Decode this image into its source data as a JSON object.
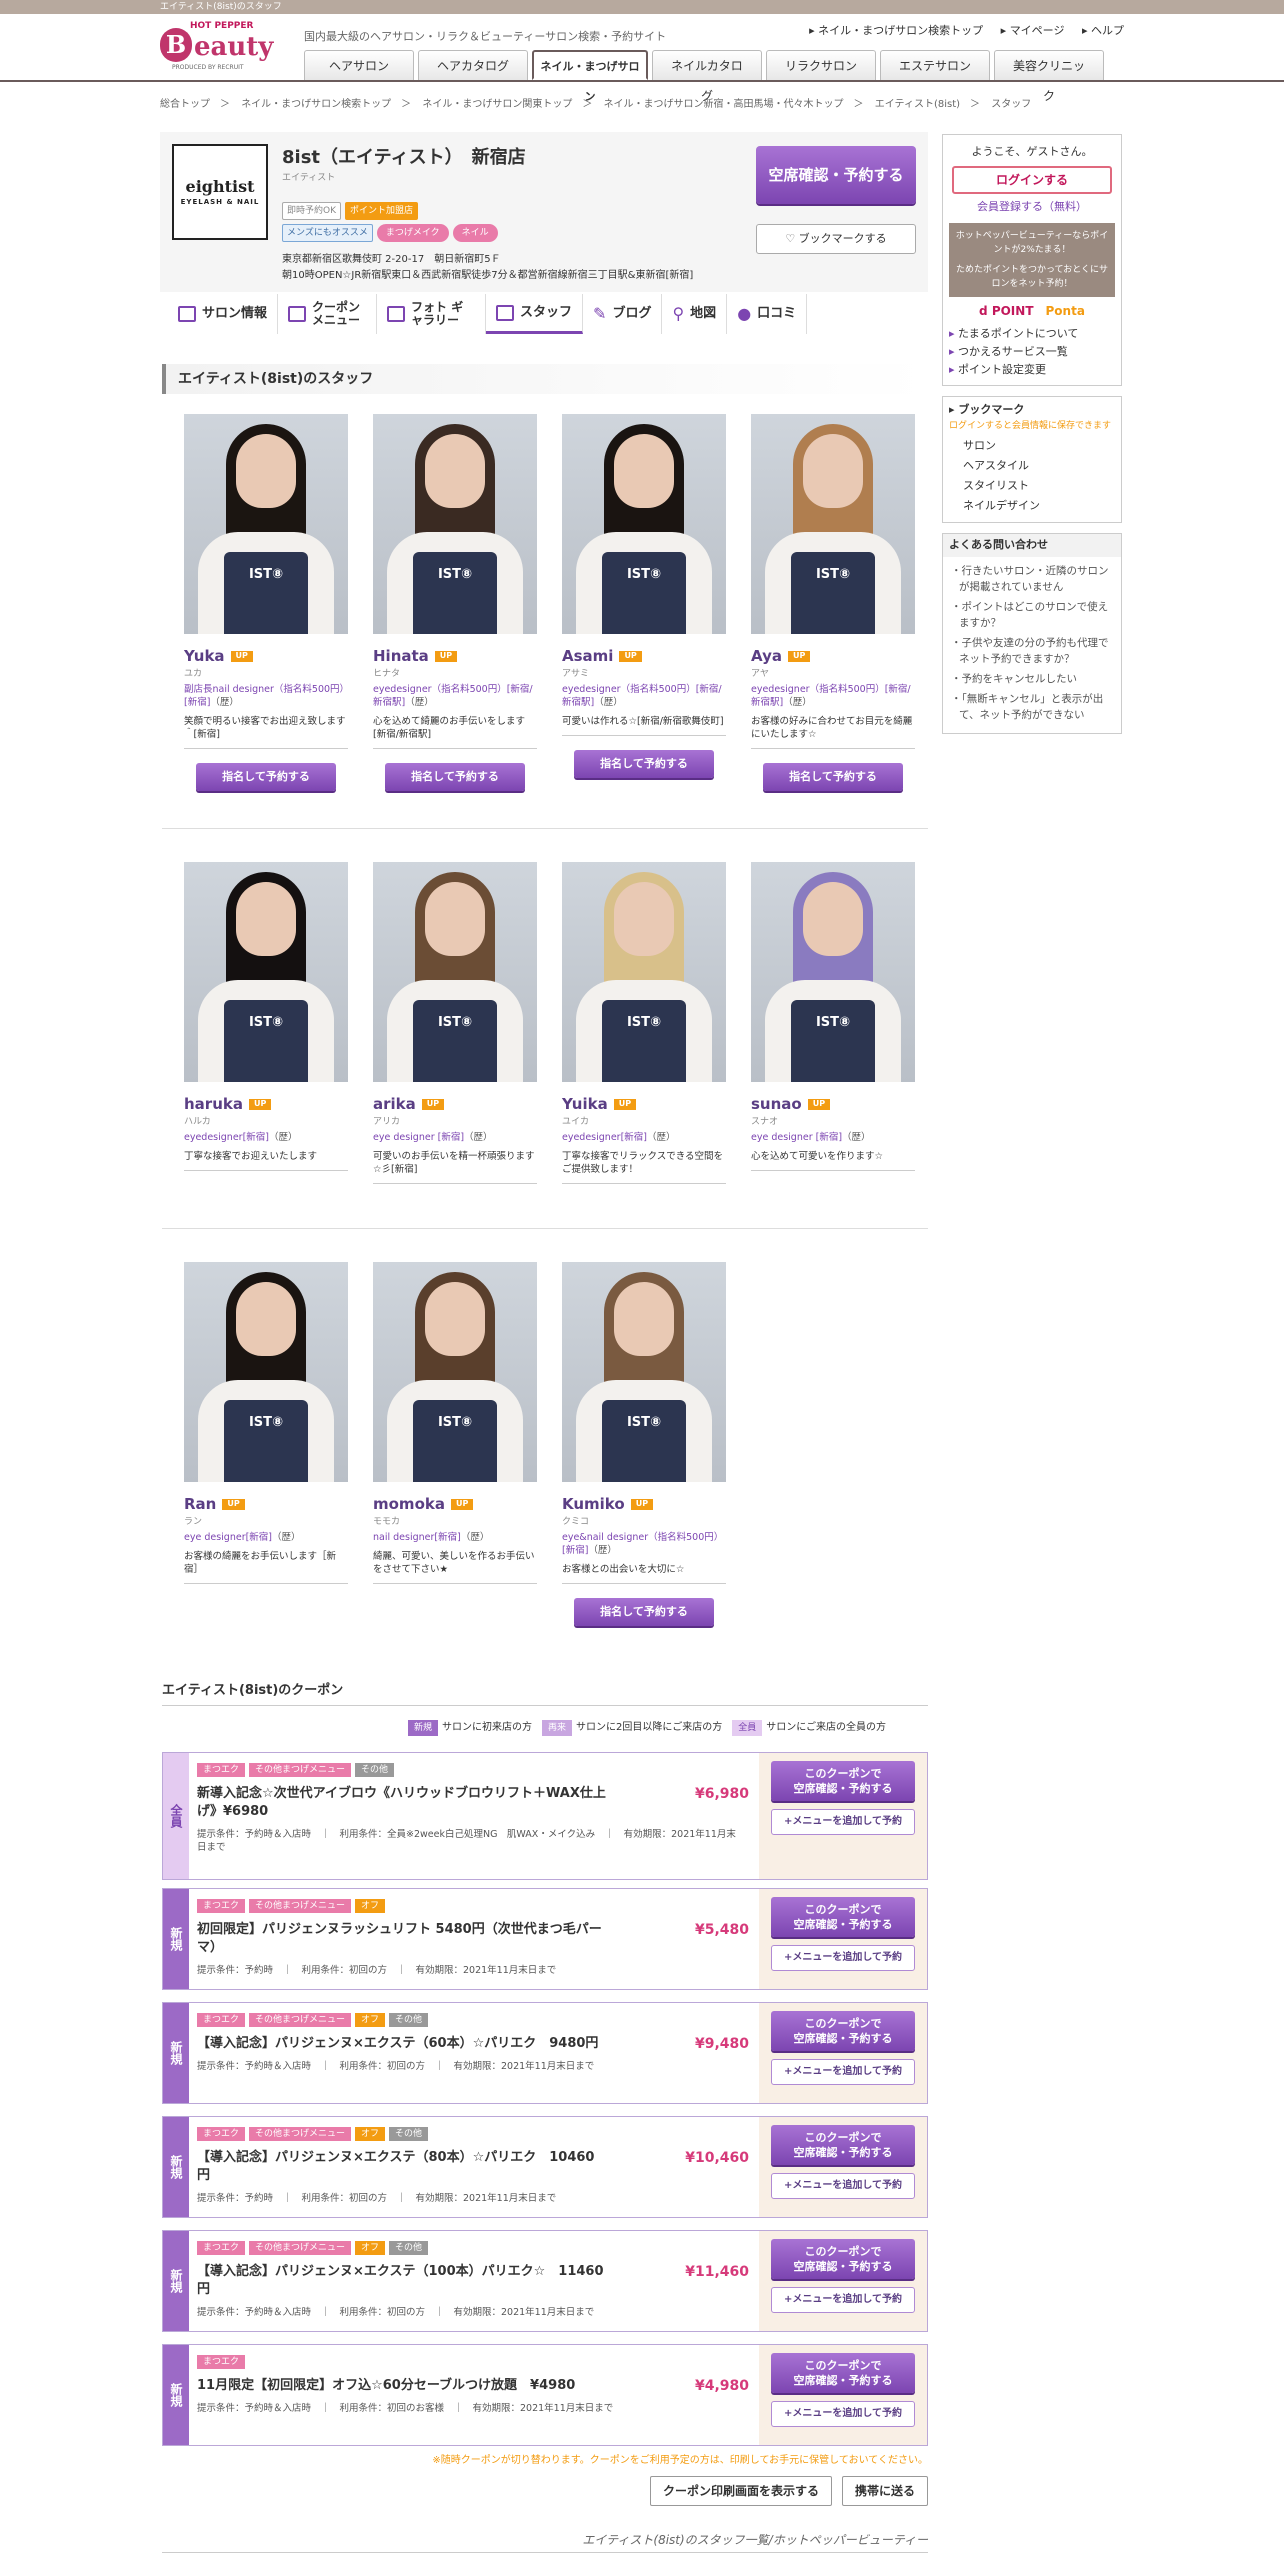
{
  "topbar": "エイティスト(8ist)のスタッフ",
  "header": {
    "logo_hp": "HOT PEPPER",
    "logo_b": "B",
    "logo_eauty": "eauty",
    "logo_prod": "PRODUCED BY RECRUIT",
    "tagline": "国内最大級のヘアサロン・リラク＆ビューティーサロン検索・予約サイト",
    "links": [
      "ネイル・まつげサロン検索トップ",
      "マイページ",
      "ヘルプ"
    ],
    "nav": [
      "ヘアサロン",
      "ヘアカタログ",
      "ネイル・まつげサロン",
      "ネイルカタログ",
      "リラクサロン",
      "エステサロン",
      "美容クリニック"
    ]
  },
  "breadcrumb": [
    "総合トップ　＞",
    "ネイル・まつげサロン検索トップ　＞",
    "ネイル・まつげサロン関東トップ　＞",
    "ネイル・まつげサロン新宿・高田馬場・代々木トップ　＞",
    "エイティスト(8ist)　＞",
    "スタッフ"
  ],
  "salon": {
    "logo": "eightist",
    "logo_sub": "EYELASH & NAIL",
    "name": "8ist（エイティスト）　新宿店",
    "kana": "エイティスト",
    "tags": [
      "即時予約OK",
      "ポイント加盟店",
      "メンズにもオススメ",
      "まつげメイク",
      "ネイル"
    ],
    "addr1": "東京都新宿区歌舞伎町 2-20-17　朝日新宿町5Ｆ",
    "addr2": "朝10時OPEN☆JR新宿駅東口＆西武新宿駅徒歩7分＆都営新宿線新宿三丁目駅&東新宿[新宿]",
    "reserve": "空席確認・予約する",
    "bookmark": "ブックマークする"
  },
  "subnav": [
    "サロン情報",
    "クーポン メニュー",
    "フォト ギャラリー",
    "スタッフ",
    "ブログ",
    "地図",
    "口コミ"
  ],
  "staff_title": "エイティスト(8ist)のスタッフ",
  "up": "UP",
  "hist": "（歴）",
  "reserve_btn": "指名して予約する",
  "staff": [
    {
      "name": "Yuka",
      "kana": "ユカ",
      "role": "副店長nail designer（指名料500円）[新宿]",
      "desc": "笑顔で明るい接客でお出迎え致します＾[新宿]",
      "hair": "#1b1511",
      "btn": true
    },
    {
      "name": "Hinata",
      "kana": "ヒナタ",
      "role": "eyedesigner（指名料500円）[新宿/新宿駅]",
      "desc": "心を込めて綺麗のお手伝いをします[新宿/新宿駅]",
      "hair": "#3a2a22",
      "btn": true
    },
    {
      "name": "Asami",
      "kana": "アサミ",
      "role": "eyedesigner（指名料500円）[新宿/新宿駅]",
      "desc": "可愛いは作れる☆[新宿/新宿歌舞伎町]",
      "hair": "#1a1411",
      "btn": true
    },
    {
      "name": "Aya",
      "kana": "アヤ",
      "role": "eyedesigner（指名料500円）[新宿/新宿駅]",
      "desc": "お客様の好みに合わせてお目元を綺麗にいたします☆",
      "hair": "#b07e4f",
      "btn": true
    },
    {
      "name": "haruka",
      "kana": "ハルカ",
      "role": "eyedesigner[新宿]",
      "desc": "丁寧な接客でお迎えいたします",
      "hair": "#141010",
      "btn": false
    },
    {
      "name": "arika",
      "kana": "アリカ",
      "role": "eye designer [新宿]",
      "desc": "可愛いのお手伝いを精一杯頑張ります☆彡[新宿]",
      "hair": "#6b4d35",
      "btn": false
    },
    {
      "name": "Yuika",
      "kana": "ユイカ",
      "role": "eyedesigner[新宿]",
      "desc": "丁寧な接客でリラックスできる空間をご提供致します！",
      "hair": "#d8c08a",
      "btn": false
    },
    {
      "name": "sunao",
      "kana": "スナオ",
      "role": "eye designer [新宿]",
      "desc": "心を込めて可愛いを作ります☆",
      "hair": "#8a7bc0",
      "btn": false
    },
    {
      "name": "Ran",
      "kana": "ラン",
      "role": "eye designer[新宿]",
      "desc": "お客様の綺麗をお手伝いします［新宿］",
      "hair": "#1a1411",
      "btn": false
    },
    {
      "name": "momoka",
      "kana": "モモカ",
      "role": "nail designer[新宿]",
      "desc": "綺麗、可愛い、美しいを作るお手伝いをさせて下さい★",
      "hair": "#5a3f2c",
      "btn": false
    },
    {
      "name": "Kumiko",
      "kana": "クミコ",
      "role": "eye&nail designer（指名料500円）[新宿]",
      "desc": "お客様との出会いを大切に☆",
      "hair": "#7a5a40",
      "btn": true
    }
  ],
  "sidebar": {
    "welcome": "ようこそ、ゲストさん。",
    "login": "ログインする",
    "register": "会員登録する（無料）",
    "point1": "ホットペッパービューティーならポイントが2%たまる！",
    "point2": "ためたポイントをつかっておとくにサロンをネット予約！",
    "dpoint": "d POINT",
    "ponta": "Ponta",
    "links": [
      "たまるポイントについて",
      "つかえるサービス一覧",
      "ポイント設定変更"
    ],
    "bm_title": "ブックマーク",
    "bm_note": "ログインすると会員情報に保存できます",
    "bm_items": [
      "サロン",
      "ヘアスタイル",
      "スタイリスト",
      "ネイルデザイン"
    ],
    "faq_title": "よくある問い合わせ",
    "faq": [
      "行きたいサロン・近隣のサロンが掲載されていません",
      "ポイントはどこのサロンで使えますか？",
      "子供や友達の分の予約も代理でネット予約できますか？",
      "予約をキャンセルしたい",
      "「無断キャンセル」と表示が出て、ネット予約ができない"
    ]
  },
  "coupon_title": "エイティスト(8ist)のクーポン",
  "legend": [
    {
      "tag": "新規",
      "text": "サロンに初来店の方",
      "color": "#9c6ac6"
    },
    {
      "tag": "再来",
      "text": "サロンに2回目以降にご来店の方",
      "color": "#c8a6e0"
    },
    {
      "tag": "全員",
      "text": "サロンにご来店の全員の方",
      "color": "#e4cbf1"
    }
  ],
  "coupon_btn1": "このクーポンで\n空席確認・予約する",
  "coupon_btn2": "+メニューを追加して予約",
  "coupons": [
    {
      "type": "全員",
      "tags": [
        "まつエク",
        "その他まつげメニュー",
        "その他"
      ],
      "name": "新導入記念☆次世代アイブロウ《ハリウッドブロウリフト＋WAX仕上げ》¥6980",
      "price": "¥6,980",
      "info": "提示条件：予約時＆入店時　｜　利用条件：全員※2week白己処理NG　肌WAX・メイク込み　｜　有効期限：2021年11月末日まで"
    },
    {
      "type": "新規",
      "tags": [
        "まつエク",
        "その他まつげメニュー",
        "オフ"
      ],
      "name": "初回限定】パリジェンヌラッシュリフト 5480円（次世代まつ毛パーマ）",
      "price": "¥5,480",
      "info": "提示条件：予約時　｜　利用条件：初回の方　｜　有効期限：2021年11月末日まで"
    },
    {
      "type": "新規",
      "tags": [
        "まつエク",
        "その他まつげメニュー",
        "オフ",
        "その他"
      ],
      "name": "【導入記念】パリジェンヌ×エクステ（60本）☆パリエク　9480円",
      "price": "¥9,480",
      "info": "提示条件：予約時＆入店時　｜　利用条件：初回の方　｜　有効期限：2021年11月末日まで"
    },
    {
      "type": "新規",
      "tags": [
        "まつエク",
        "その他まつげメニュー",
        "オフ",
        "その他"
      ],
      "name": "【導入記念】パリジェンヌ×エクステ（80本）☆パリエク　10460円",
      "price": "¥10,460",
      "info": "提示条件：予約時　｜　利用条件：初回の方　｜　有効期限：2021年11月末日まで"
    },
    {
      "type": "新規",
      "tags": [
        "まつエク",
        "その他まつげメニュー",
        "オフ",
        "その他"
      ],
      "name": "【導入記念】パリジェンヌ×エクステ（100本）パリエク☆　11460円",
      "price": "¥11,460",
      "info": "提示条件：予約時＆入店時　｜　利用条件：初回の方　｜　有効期限：2021年11月末日まで"
    },
    {
      "type": "新規",
      "tags": [
        "まつエク"
      ],
      "name": "11月限定【初回限定】オフ込☆60分セーブルつけ放題　¥4980",
      "price": "¥4,980",
      "info": "提示条件：予約時＆入店時　｜　利用条件：初回のお客様　｜　有効期限：2021年11月末日まで"
    }
  ],
  "notice": "※随時クーポンが切り替わります。クーポンをご利用予定の方は、印刷してお手元に保管しておいてください。",
  "print_btn": "クーポン印刷画面を表示する",
  "mobile_btn": "携帯に送る",
  "footer": "エイティスト(8ist)のスタッフ一覧/ホットペッパービューティー"
}
